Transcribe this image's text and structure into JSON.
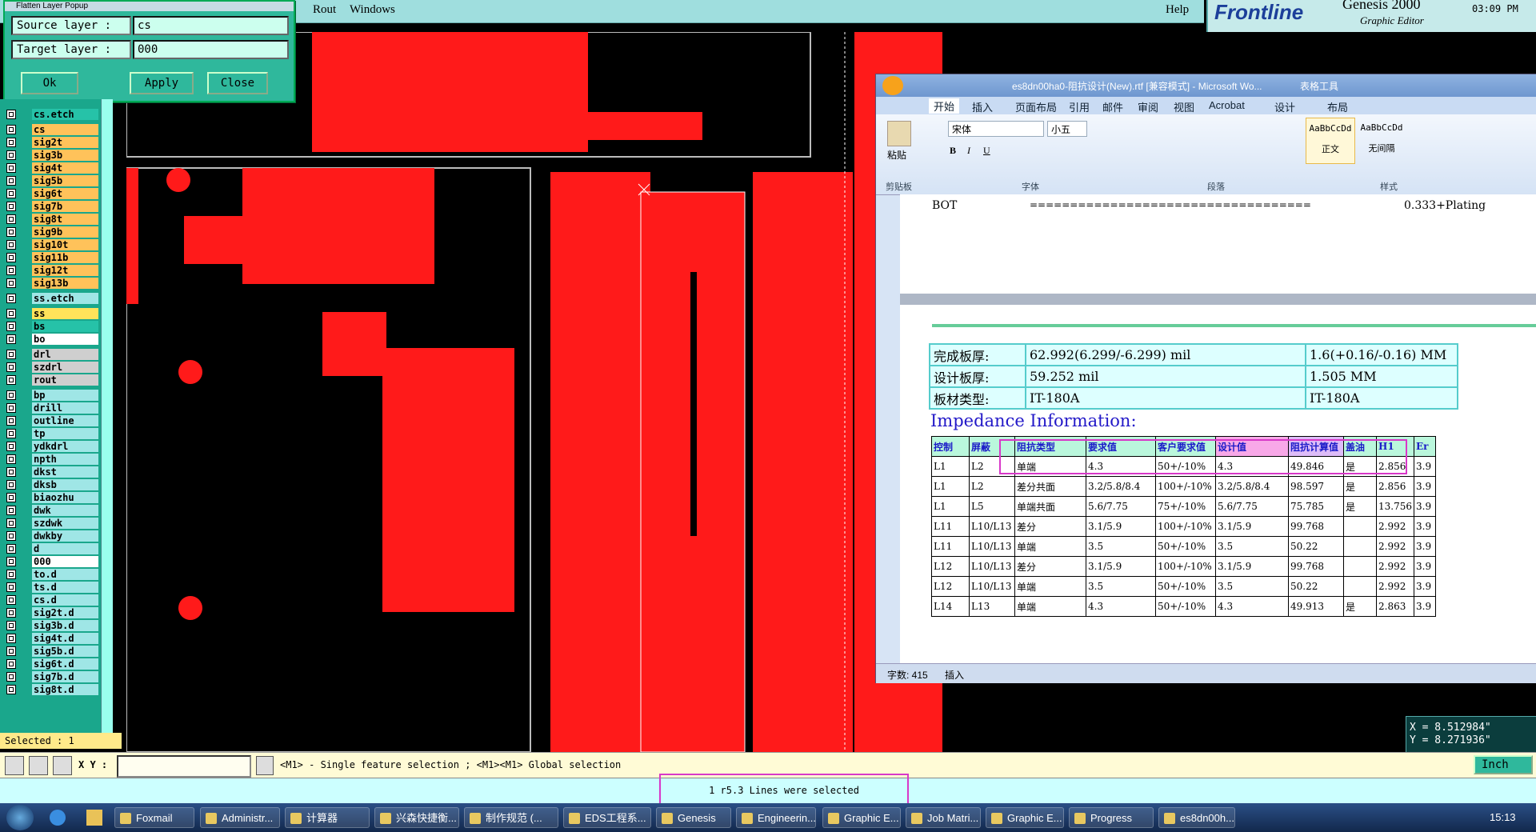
{
  "menu": {
    "items": [
      "Rout",
      "Windows"
    ],
    "help": "Help"
  },
  "logo": {
    "brand": "Frontline",
    "product": "Genesis 2000",
    "subtitle": "Graphic Editor",
    "time": "03:09 PM"
  },
  "popup": {
    "title": "Flatten Layer Popup",
    "source_label": "Source layer :",
    "source_value": "cs",
    "target_label": "Target layer :",
    "target_value": "000",
    "ok": "Ok",
    "apply": "Apply",
    "close": "Close"
  },
  "layers": [
    {
      "name": "cs.etch",
      "color": "#26c2a8"
    },
    {
      "name": "cs",
      "color": "#ffc25a"
    },
    {
      "name": "sig2t",
      "color": "#ffc25a"
    },
    {
      "name": "sig3b",
      "color": "#ffc25a"
    },
    {
      "name": "sig4t",
      "color": "#ffc25a"
    },
    {
      "name": "sig5b",
      "color": "#ffc25a"
    },
    {
      "name": "sig6t",
      "color": "#ffc25a"
    },
    {
      "name": "sig7b",
      "color": "#ffc25a"
    },
    {
      "name": "sig8t",
      "color": "#ffc25a"
    },
    {
      "name": "sig9b",
      "color": "#ffc25a"
    },
    {
      "name": "sig10t",
      "color": "#ffc25a"
    },
    {
      "name": "sig11b",
      "color": "#ffc25a"
    },
    {
      "name": "sig12t",
      "color": "#ffc25a"
    },
    {
      "name": "sig13b",
      "color": "#ffc25a"
    },
    {
      "name": "ss.etch",
      "color": "#9fe6e6"
    },
    {
      "name": "ss",
      "color": "#ffe35a"
    },
    {
      "name": "bs",
      "color": "#26c2a8"
    },
    {
      "name": "bo",
      "color": "#ffffff"
    },
    {
      "name": "drl",
      "color": "#cfcfcf"
    },
    {
      "name": "szdrl",
      "color": "#cfcfcf"
    },
    {
      "name": "rout",
      "color": "#cfcfcf"
    },
    {
      "name": "bp",
      "color": "#9fe6e6"
    },
    {
      "name": "drill",
      "color": "#9fe6e6"
    },
    {
      "name": "outline",
      "color": "#9fe6e6"
    },
    {
      "name": "tp",
      "color": "#9fe6e6"
    },
    {
      "name": "ydkdrl",
      "color": "#9fe6e6"
    },
    {
      "name": "npth",
      "color": "#9fe6e6"
    },
    {
      "name": "dkst",
      "color": "#9fe6e6"
    },
    {
      "name": "dksb",
      "color": "#9fe6e6"
    },
    {
      "name": "biaozhu",
      "color": "#9fe6e6"
    },
    {
      "name": "dwk",
      "color": "#9fe6e6"
    },
    {
      "name": "szdwk",
      "color": "#9fe6e6"
    },
    {
      "name": "dwkby",
      "color": "#9fe6e6"
    },
    {
      "name": "d",
      "color": "#9fe6e6"
    },
    {
      "name": "000",
      "color": "#ffffff"
    },
    {
      "name": "to.d",
      "color": "#9fe6e6"
    },
    {
      "name": "ts.d",
      "color": "#9fe6e6"
    },
    {
      "name": "cs.d",
      "color": "#9fe6e6"
    },
    {
      "name": "sig2t.d",
      "color": "#9fe6e6"
    },
    {
      "name": "sig3b.d",
      "color": "#9fe6e6"
    },
    {
      "name": "sig4t.d",
      "color": "#9fe6e6"
    },
    {
      "name": "sig5b.d",
      "color": "#9fe6e6"
    },
    {
      "name": "sig6t.d",
      "color": "#9fe6e6"
    },
    {
      "name": "sig7b.d",
      "color": "#9fe6e6"
    },
    {
      "name": "sig8t.d",
      "color": "#9fe6e6"
    }
  ],
  "selected": "Selected : 1",
  "cmd": {
    "xy_label": "X Y :",
    "hint": "<M1> - Single feature selection ; <M1><M1> Global selection",
    "unit": "Inch"
  },
  "status": {
    "message": "1 r5.3 Lines were selected"
  },
  "coords": {
    "x": "X = 8.512984\"",
    "y": "Y = 8.271936\""
  },
  "word": {
    "title": "es8dn00ha0-阻抗设计(New).rtf [兼容模式] - Microsoft Wo...",
    "table_tools": "表格工具",
    "tabs": [
      "开始",
      "插入",
      "页面布局",
      "引用",
      "邮件",
      "审阅",
      "视图",
      "Acrobat",
      "设计",
      "布局"
    ],
    "font_name": "宋体",
    "font_size": "小五",
    "styles": [
      "AaBbCcDd",
      "AaBbCcDd"
    ],
    "style_names": [
      "正文",
      "无间隔"
    ],
    "groups": [
      "剪贴板",
      "字体",
      "段落",
      "样式"
    ],
    "paste": "粘贴",
    "page1_line": {
      "label": "BOT",
      "fill": "===================================",
      "value": "0.333+Plating"
    },
    "info_rows": [
      [
        "完成板厚:",
        "62.992(6.299/-6.299) mil",
        "1.6(+0.16/-0.16) MM"
      ],
      [
        "设计板厚:",
        "59.252 mil",
        "1.505 MM"
      ],
      [
        "板材类型:",
        "IT-180A",
        "IT-180A"
      ]
    ],
    "heading": "Impedance Information:",
    "table_headers": [
      "控制",
      "屏蔽",
      "阻抗类型",
      "要求值",
      "客户要求值",
      "设计值",
      "阻抗计算值",
      "盖油",
      "H1",
      "Er"
    ],
    "table_rows": [
      [
        "L1",
        "L2",
        "单端",
        "4.3",
        "50+/-10%",
        "4.3",
        "49.846",
        "是",
        "2.856",
        "3.9"
      ],
      [
        "L1",
        "L2",
        "差分共面",
        "3.2/5.8/8.4",
        "100+/-10%",
        "3.2/5.8/8.4",
        "98.597",
        "是",
        "2.856",
        "3.9"
      ],
      [
        "L1",
        "L5",
        "单端共面",
        "5.6/7.75",
        "75+/-10%",
        "5.6/7.75",
        "75.785",
        "是",
        "13.756",
        "3.9"
      ],
      [
        "L11",
        "L10/L13",
        "差分",
        "3.1/5.9",
        "100+/-10%",
        "3.1/5.9",
        "99.768",
        "",
        "2.992",
        "3.9"
      ],
      [
        "L11",
        "L10/L13",
        "单端",
        "3.5",
        "50+/-10%",
        "3.5",
        "50.22",
        "",
        "2.992",
        "3.9"
      ],
      [
        "L12",
        "L10/L13",
        "差分",
        "3.1/5.9",
        "100+/-10%",
        "3.1/5.9",
        "99.768",
        "",
        "2.992",
        "3.9"
      ],
      [
        "L12",
        "L10/L13",
        "单端",
        "3.5",
        "50+/-10%",
        "3.5",
        "50.22",
        "",
        "2.992",
        "3.9"
      ],
      [
        "L14",
        "L13",
        "单端",
        "4.3",
        "50+/-10%",
        "4.3",
        "49.913",
        "是",
        "2.863",
        "3.9"
      ]
    ],
    "wordcount": "字数: 415",
    "insert_mode": "插入"
  },
  "taskbar": {
    "items": [
      "Foxmail",
      "Administr...",
      "计算器",
      "兴森快捷衡...",
      "制作规范 (...",
      "EDS工程系...",
      "Genesis",
      "Engineerin...",
      "Graphic E...",
      "Job Matri...",
      "Graphic E...",
      "Progress",
      "es8dn00h..."
    ],
    "clock": "15:13"
  },
  "colors": {
    "copper": "#ff1a1a",
    "panel": "#1aa78c",
    "highlight": "#d838c8"
  }
}
